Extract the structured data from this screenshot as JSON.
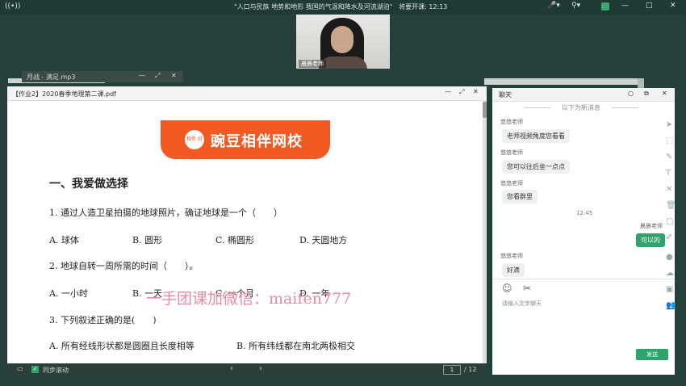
{
  "topbar": {
    "live_icon": "broadcast-icon",
    "title": "\"人口与民族 地势和地形 我国的气温和降水及河流湖泊\"",
    "countdown": "将要开课: 12:13"
  },
  "camera": {
    "name": "晨晨老师"
  },
  "mp3_window": {
    "title": "月战 - 满足.mp3"
  },
  "pdf_window": {
    "title": "【作业2】2020春季地理第二课.pdf",
    "brand_logo_text": "相伴 好学习",
    "brand_name": "豌豆相伴网校",
    "section_title": "一、我爱做选择",
    "q1": "1. 通过人造卫星拍摄的地球照片，确证地球是一个（　　）",
    "q1_opts": [
      "A. 球体",
      "B. 圆形",
      "C. 椭圆形",
      "D. 天圆地方"
    ],
    "q2": "2. 地球自转一周所需的时间（　　）。",
    "q2_opts": [
      "A. 一小时",
      "B. 一天",
      "C. 一个月",
      "D. 一年"
    ],
    "q3": "3. 下列叙述正确的是(　　)",
    "q3_opts": [
      "A. 所有经线形状都是圆圈且长度相等",
      "B. 所有纬线都在南北两极相交"
    ],
    "watermark": "一手团课加微信：maifen777"
  },
  "bottombar": {
    "sync_label": "同步滚动",
    "current_page": "1",
    "total_pages": "/ 12"
  },
  "chat": {
    "title": "聊天",
    "new_msg_sep": "以下为新消息",
    "messages": [
      {
        "sender": "悠悠老师",
        "text": "老师视频角度您看看"
      },
      {
        "sender": "悠悠老师",
        "text": "您可以往后坐一点点"
      },
      {
        "sender": "悠悠老师",
        "text": "您看群里"
      }
    ],
    "time": "12:45",
    "my_name": "晨晨老师",
    "my_text": "可以的",
    "last_sender": "悠悠老师",
    "last_text": "好滴",
    "input_placeholder": "请输入文字聊天",
    "send_label": "发送"
  },
  "colors": {
    "accent": "#2fa36b",
    "brand": "#f15a22",
    "board": "#25403a"
  }
}
